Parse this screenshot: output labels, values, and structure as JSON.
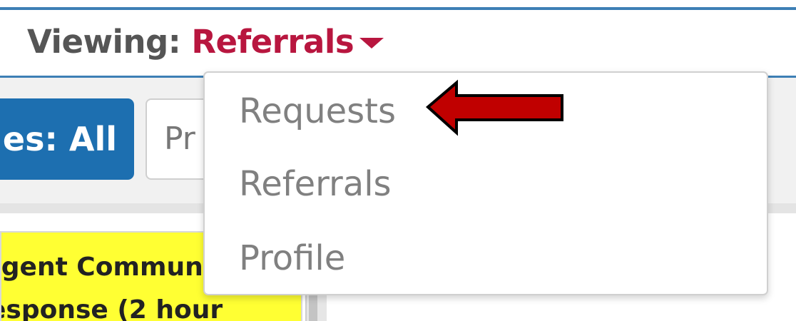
{
  "header": {
    "label": "Viewing:",
    "current_view": "Referrals"
  },
  "toolbar": {
    "filter_button_label": "es: All",
    "search_partial_text": "Pr"
  },
  "dropdown": {
    "items": [
      {
        "label": "Requests"
      },
      {
        "label": "Referrals"
      },
      {
        "label": "Profile"
      }
    ]
  },
  "content": {
    "alert_line_1": "rgent Commun",
    "alert_line_2": "esponse (2 hour"
  },
  "colors": {
    "accent_blue": "#3d7fb5",
    "view_red": "#b8163f",
    "filter_button_blue": "#1d6fb0",
    "alert_yellow": "#ffff33",
    "annotation_arrow_red": "#c00000"
  },
  "icons": {
    "caret": "caret-down-icon",
    "annotation": "arrow-left-icon"
  }
}
